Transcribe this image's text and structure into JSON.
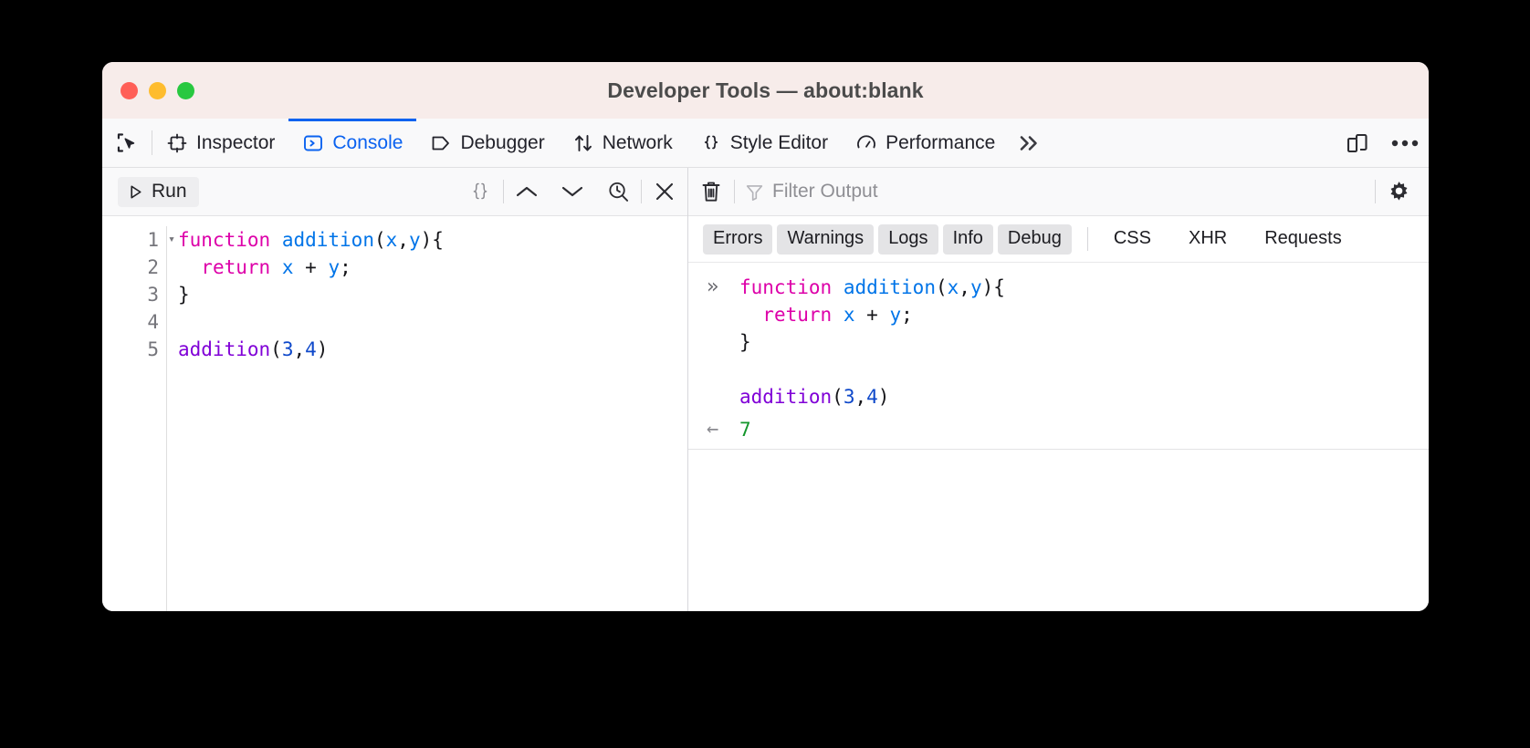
{
  "window": {
    "title": "Developer Tools — about:blank",
    "traffic_lights": [
      {
        "name": "close",
        "color": "#ff5f57"
      },
      {
        "name": "minimize",
        "color": "#febc2e"
      },
      {
        "name": "zoom",
        "color": "#28c840"
      }
    ]
  },
  "toolbox": {
    "picker_icon": "element-picker-icon",
    "tabs": [
      {
        "label": "Inspector",
        "icon": "inspector-icon",
        "selected": false
      },
      {
        "label": "Console",
        "icon": "console-icon",
        "selected": true
      },
      {
        "label": "Debugger",
        "icon": "debugger-icon",
        "selected": false
      },
      {
        "label": "Network",
        "icon": "network-icon",
        "selected": false
      },
      {
        "label": "Style Editor",
        "icon": "style-editor-icon",
        "selected": false
      },
      {
        "label": "Performance",
        "icon": "performance-icon",
        "selected": false
      }
    ],
    "overflow_label": "»",
    "responsive_mode_icon": "responsive-design-mode-icon",
    "meatball_icon": "more-options-icon",
    "accent_color": "#0a62f0"
  },
  "editor_toolbar": {
    "run_label": "Run",
    "run_icon": "play-icon",
    "pretty_print_label": "{ }",
    "prev_expression_icon": "chevron-up-icon",
    "next_expression_icon": "chevron-down-icon",
    "history_icon": "history-search-icon",
    "close_icon": "close-icon"
  },
  "console_toolbar": {
    "clear_icon": "trash-icon",
    "filter_icon": "funnel-icon",
    "filter_placeholder": "Filter Output",
    "filter_value": "",
    "settings_icon": "gear-icon"
  },
  "filter_row": {
    "toggles": [
      {
        "label": "Errors",
        "active": true
      },
      {
        "label": "Warnings",
        "active": true
      },
      {
        "label": "Logs",
        "active": true
      },
      {
        "label": "Info",
        "active": true
      },
      {
        "label": "Debug",
        "active": true
      }
    ],
    "extra": [
      {
        "label": "CSS",
        "active": false
      },
      {
        "label": "XHR",
        "active": false
      },
      {
        "label": "Requests",
        "active": false
      }
    ]
  },
  "editor": {
    "line_numbers": [
      "1",
      "2",
      "3",
      "4",
      "5"
    ],
    "fold_arrow_on_line": 1,
    "fold_arrow_glyph": "▾",
    "source_text": "function addition(x,y){\n  return x + y;\n}\n\naddition(3,4)"
  },
  "console": {
    "input_marker": "»",
    "result_marker": "←",
    "entries": [
      {
        "type": "input",
        "text": "function addition(x,y){\n  return x + y;\n}\n\naddition(3,4)"
      },
      {
        "type": "result",
        "value": "7"
      }
    ]
  },
  "colors": {
    "keyword": "#dd00a9",
    "function_name": "#0074e8",
    "identifier": "#0074e8",
    "call_name": "#8000d7",
    "number": "#0e48ca",
    "punctuation": "#16161a",
    "result": "#12962a",
    "titlebar_bg": "#f7ecea",
    "toolbar_bg": "#f9f9fa"
  }
}
